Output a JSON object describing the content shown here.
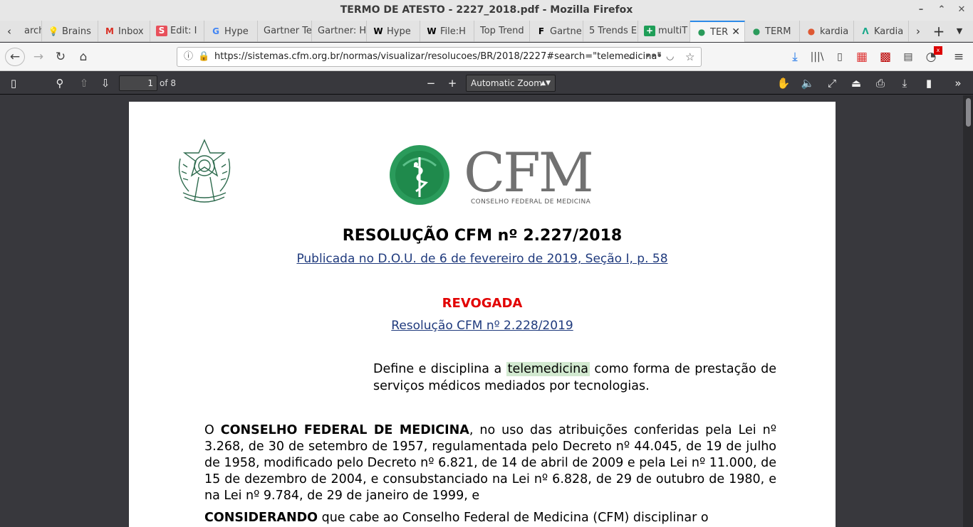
{
  "window": {
    "title": "TERMO DE ATESTO - 2227_2018.pdf - Mozilla Firefox"
  },
  "tabs": [
    {
      "icon": "",
      "label": "arch"
    },
    {
      "icon": "bulb-icon",
      "label": "Brains"
    },
    {
      "icon": "gmail-icon",
      "label": "Inbox"
    },
    {
      "icon": "s-icon",
      "label": "Edit: I"
    },
    {
      "icon": "g-icon",
      "label": "Hype"
    },
    {
      "icon": "",
      "label": "Gartner Te"
    },
    {
      "icon": "",
      "label": "Gartner: H"
    },
    {
      "icon": "wikipedia-icon",
      "label": "Hype"
    },
    {
      "icon": "wikipedia-icon",
      "label": "File:H"
    },
    {
      "icon": "",
      "label": "Top Trend"
    },
    {
      "icon": "f-icon",
      "label": "Gartne"
    },
    {
      "icon": "",
      "label": "5 Trends E"
    },
    {
      "icon": "plus-green-icon",
      "label": "multiT"
    },
    {
      "icon": "cfm-icon",
      "label": "TER",
      "active": true
    },
    {
      "icon": "cfm-icon",
      "label": "TERM"
    },
    {
      "icon": "duckduckgo-icon",
      "label": "kardia"
    },
    {
      "icon": "kardia-icon",
      "label": "Kardia"
    }
  ],
  "navbar": {
    "url": "https://sistemas.cfm.org.br/normas/visualizar/resolucoes/BR/2018/2227#search=\"telemedicina\""
  },
  "pdf_toolbar": {
    "page_number": "1",
    "page_count": "of 8",
    "zoom": "Automatic Zoom"
  },
  "document": {
    "logo_text": "CFM",
    "logo_subtitle": "CONSELHO FEDERAL DE MEDICINA",
    "title": "RESOLUÇÃO CFM nº 2.227/2018",
    "publication_link": "Publicada no D.O.U. de 6 de fevereiro de 2019, Seção I, p. 58",
    "revoked_label": "REVOGADA",
    "revoked_by_link": "Resolução CFM nº 2.228/2019",
    "summary_before": "Define e disciplina a ",
    "summary_highlight": "telemedicina",
    "summary_after": " como forma de prestação de serviços médicos mediados por tecnologias.",
    "para1_bold": "CONSELHO FEDERAL DE MEDICINA",
    "para1_prefix": "O ",
    "para1_rest": ", no uso das atribuições conferidas pela Lei nº 3.268, de 30 de setembro de 1957, regulamentada pelo Decreto nº 44.045, de 19 de julho de 1958, modificado pelo Decreto nº 6.821, de 14 de abril de 2009 e pela Lei nº 11.000, de 15 de dezembro de 2004, e consubstanciado na Lei nº 6.828, de 29 de outubro de 1980, e na Lei nº 9.784, de 29 de janeiro de 1999, e",
    "para2_bold": "CONSIDERANDO",
    "para2_rest": " que cabe ao Conselho Federal de Medicina (CFM) disciplinar o"
  }
}
